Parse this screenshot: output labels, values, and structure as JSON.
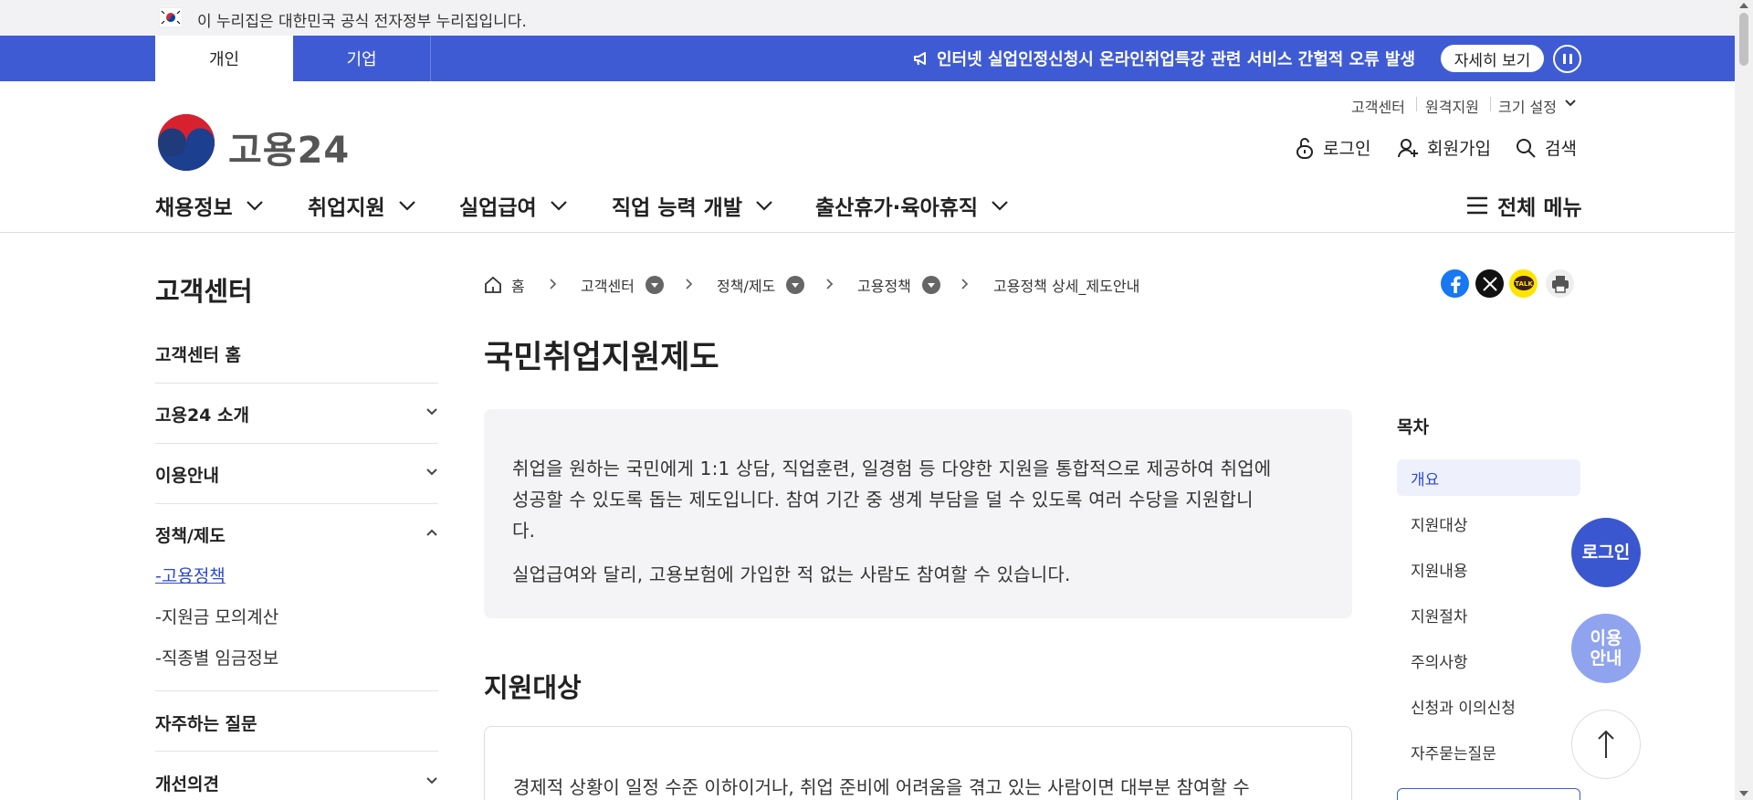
{
  "gov_banner": {
    "text": "이 누리집은 대한민국 공식 전자정부 누리집입니다."
  },
  "top_tabs": [
    {
      "label": "개인"
    },
    {
      "label": "기업"
    }
  ],
  "notice": {
    "text": "인터넷 실업인정신청시 온라인취업특강 관련 서비스 간헐적 오류 발생",
    "more_label": "자세히 보기"
  },
  "header": {
    "logo_text": "고용24",
    "util_links": [
      {
        "label": "고객센터"
      },
      {
        "label": "원격지원"
      },
      {
        "label": "크기 설정"
      }
    ],
    "actions": {
      "login": "로그인",
      "signup": "회원가입",
      "search": "검색"
    }
  },
  "gnb": [
    {
      "label": "채용정보"
    },
    {
      "label": "취업지원"
    },
    {
      "label": "실업급여"
    },
    {
      "label": "직업 능력 개발"
    },
    {
      "label": "출산휴가·육아휴직"
    }
  ],
  "all_menu_label": "전체 메뉴",
  "sidebar": {
    "title": "고객센터",
    "items": [
      {
        "label": "고객센터 홈"
      },
      {
        "label": "고용24 소개"
      },
      {
        "label": "이용안내"
      },
      {
        "label": "정책/제도"
      },
      {
        "label": "자주하는 질문"
      },
      {
        "label": "개선의견"
      }
    ],
    "sub_items": [
      {
        "label": "-고용정책"
      },
      {
        "label": "-지원금 모의계산"
      },
      {
        "label": "-직종별 임금정보"
      }
    ]
  },
  "breadcrumb": [
    {
      "label": "홈"
    },
    {
      "label": "고객센터"
    },
    {
      "label": "정책/제도"
    },
    {
      "label": "고용정책"
    },
    {
      "label": "고용정책 상세_제도안내"
    }
  ],
  "share": {
    "facebook_color": "#1877f2",
    "x_color": "#111111",
    "kakao_color": "#fee500",
    "kakao_text": "TALK"
  },
  "page_title": "국민취업지원제도",
  "intro": {
    "line1": "취업을 원하는 국민에게 1:1 상담, 직업훈련, 일경험 등 다양한 지원을 통합적으로 제공하여 취업에",
    "line2": "성공할 수 있도록 돕는 제도입니다. 참여 기간 중 생계 부담을 덜 수 있도록 여러 수당을 지원합니",
    "line3": "다.",
    "line4": "실업급여와 달리, 고용보험에 가입한 적 없는 사람도 참여할 수 있습니다."
  },
  "section": {
    "title": "지원대상",
    "text": "경제적 상황이 일정 수준 이하이거나, 취업 준비에 어려움을 겪고 있는 사람이면 대부분 참여할 수"
  },
  "toc": {
    "title": "목차",
    "items": [
      {
        "label": "개요"
      },
      {
        "label": "지원대상"
      },
      {
        "label": "지원내용"
      },
      {
        "label": "지원절차"
      },
      {
        "label": "주의사항"
      },
      {
        "label": "신청과 이의신청"
      },
      {
        "label": "자주묻는질문"
      }
    ]
  },
  "floating": {
    "login_label": "로그인",
    "guide_line1": "이용",
    "guide_line2": "안내"
  },
  "colors": {
    "primary": "#3f5bd4",
    "float_login": "#3a57d0",
    "float_guide": "#8fa3ef"
  }
}
